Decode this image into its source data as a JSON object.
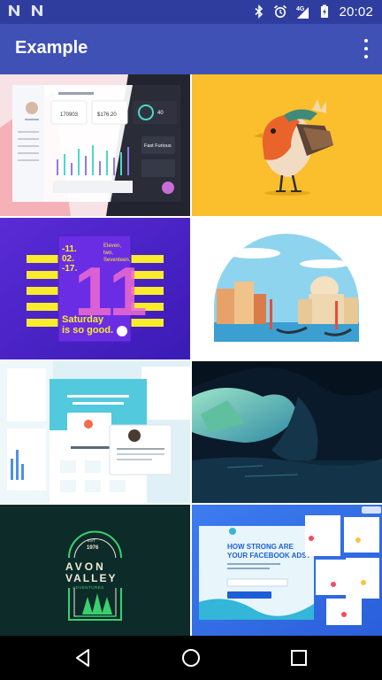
{
  "status_bar": {
    "notification_icons": [
      "n-notification-icon",
      "n-notification-icon"
    ],
    "icons": [
      "bluetooth-icon",
      "alarm-icon",
      "signal-4g-icon",
      "battery-charging-icon"
    ],
    "network_label": "4G",
    "time": "20:02"
  },
  "app_bar": {
    "title": "Example",
    "overflow_icon": "more-vert-icon"
  },
  "gallery": {
    "tiles": [
      {
        "subject": "dashboard ui mockup",
        "stat_1": "170903",
        "stat_2": "$176.20",
        "stat_3": "40",
        "side_label": "Fast Furious"
      },
      {
        "subject": "robin bird illustration"
      },
      {
        "subject": "event poster",
        "date_line": "-11.",
        "date_line_2": "02.",
        "date_line_3": "-17.",
        "big_number": "11",
        "side_text_1": "Eleven,",
        "side_text_2": "two,",
        "side_text_3": "Seventeen.",
        "tagline_1": "Saturday",
        "tagline_2": "is so good."
      },
      {
        "subject": "venice city illustration"
      },
      {
        "subject": "landing page mockup"
      },
      {
        "subject": "cave landscape illustration"
      },
      {
        "subject": "avon valley badge",
        "est_label": "EST",
        "year": "1976",
        "line_1": "AVON",
        "line_2": "VALLEY",
        "line_3": "ADVENTURES"
      },
      {
        "subject": "facebook ads landing page",
        "headline_1": "HOW STRONG ARE",
        "headline_2": "YOUR FACEBOOK ADS?"
      }
    ]
  },
  "nav_bar": {
    "buttons": [
      "back-icon",
      "home-icon",
      "recents-icon"
    ]
  },
  "colors": {
    "status_bar": "#2f3e9e",
    "app_bar": "#3f51b5",
    "on_primary": "#ffffff",
    "nav_bar": "#000000"
  }
}
